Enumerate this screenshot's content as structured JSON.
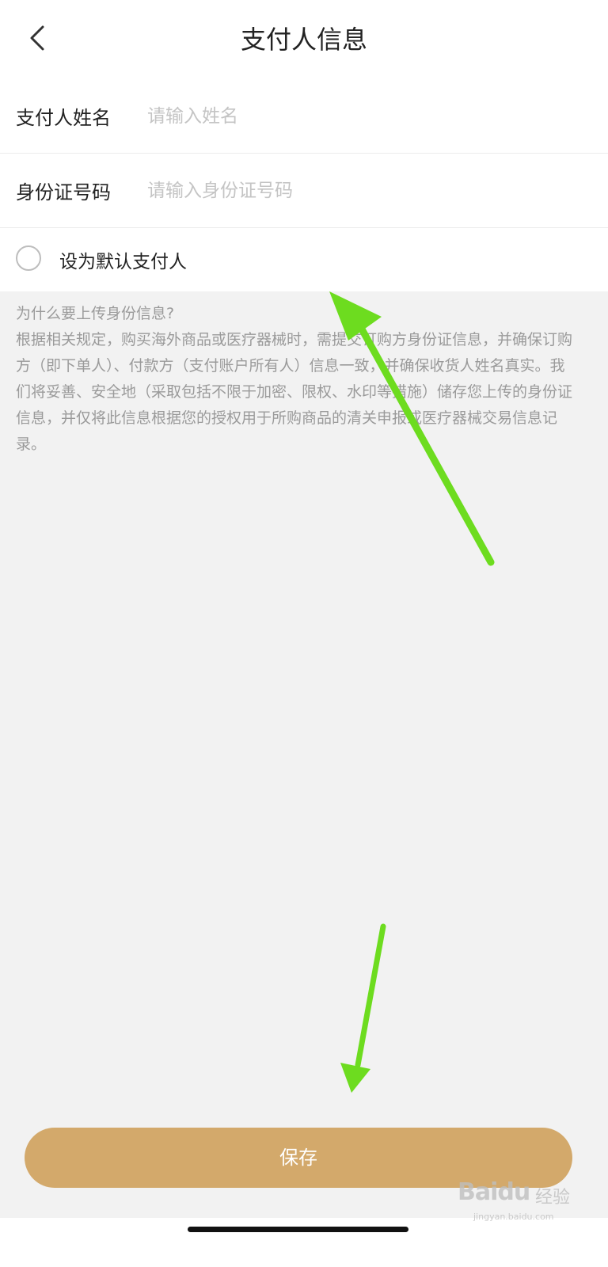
{
  "header": {
    "title": "支付人信息",
    "back_icon": "chevron-left-icon"
  },
  "form": {
    "name_label": "支付人姓名",
    "name_placeholder": "请输入姓名",
    "name_value": "",
    "id_label": "身份证号码",
    "id_placeholder": "请输入身份证号码",
    "id_value": "",
    "default_label": "设为默认支付人",
    "default_checked": false
  },
  "info": {
    "question": "为什么要上传身份信息?",
    "body": "根据相关规定，购买海外商品或医疗器械时，需提交订购方身份证信息，并确保订购方（即下单人）、付款方（支付账户所有人）信息一致，并确保收货人姓名真实。我们将妥善、安全地（采取包括不限于加密、限权、水印等措施）储存您上传的身份证信息，并仅将此信息根据您的授权用于所购商品的清关申报或医疗器械交易信息记录。"
  },
  "footer": {
    "save_label": "保存"
  },
  "watermark": {
    "logo": "Baidu",
    "suffix": "经验",
    "url": "jingyan.baidu.com"
  },
  "colors": {
    "accent": "#d3a96b",
    "annotation": "#6ddc1f",
    "background": "#f2f2f2"
  }
}
